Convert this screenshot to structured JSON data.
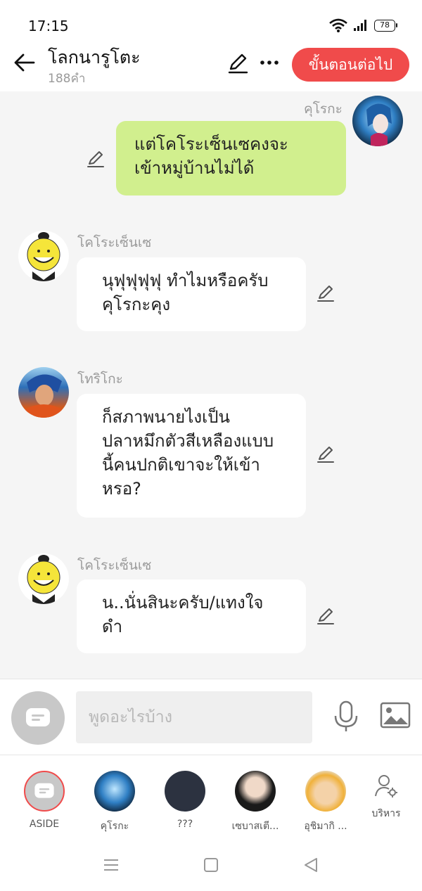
{
  "status_bar": {
    "time": "17:15",
    "battery": "78"
  },
  "header": {
    "title": "โลกนารูโตะ",
    "word_count": "188คำ",
    "next_label": "ขั้นตอนต่อไป"
  },
  "messages": [
    {
      "sender": "คุโรกะ",
      "text_lines": [
        "แต่โคโระเซ็นเซคงจะ",
        "เข้าหมู่บ้านไม่ได้"
      ],
      "mine": true
    },
    {
      "sender": "โคโระเซ็นเซ",
      "text_lines": [
        "นุฟุฟุฟุฟุ ทำไมหรือครับ",
        "คุโรกะคุง"
      ],
      "mine": false
    },
    {
      "sender": "โทริโกะ",
      "text_lines": [
        "ก็สภาพนายไงเป็น",
        "ปลาหมึกตัวสีเหลืองแบบ",
        "นี้คนปกติเขาจะให้เข้า",
        "หรอ?"
      ],
      "mine": false
    },
    {
      "sender": "โคโระเซ็นเซ",
      "text_lines": [
        "น..นั่นสินะครับ/แทงใจ",
        "ดำ"
      ],
      "mine": false
    }
  ],
  "input": {
    "placeholder": "พูดอะไรบ้าง"
  },
  "characters": [
    {
      "name": "ASIDE"
    },
    {
      "name": "คุโรกะ"
    },
    {
      "name": "???"
    },
    {
      "name": "เซบาสเตี..."
    },
    {
      "name": "อุชิมากิ ..."
    },
    {
      "name": "บริหาร"
    }
  ],
  "colors": {
    "accent": "#f04b4b",
    "my_bubble": "#d1ef8e",
    "background": "#f5f5f5"
  }
}
